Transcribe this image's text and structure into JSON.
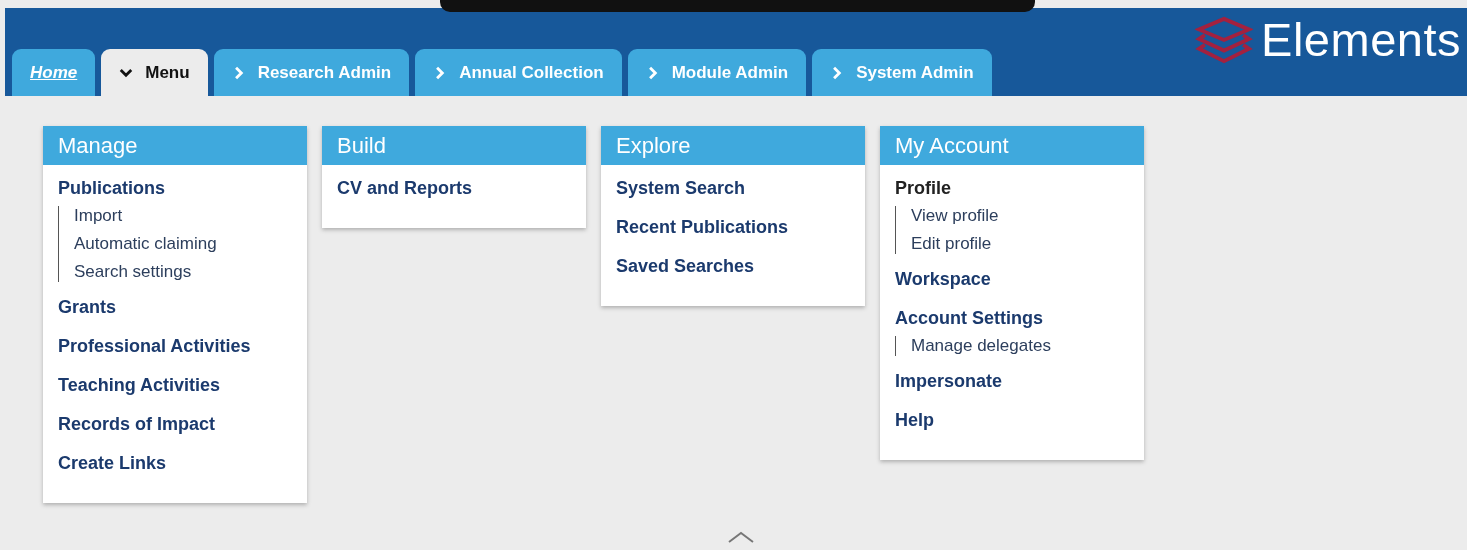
{
  "logo": {
    "text": "Elements"
  },
  "tabs": [
    {
      "label": "Home",
      "kind": "link",
      "selected": false
    },
    {
      "label": "Menu",
      "kind": "menu",
      "selected": true
    },
    {
      "label": "Research Admin",
      "kind": "menu",
      "selected": false
    },
    {
      "label": "Annual Collection",
      "kind": "menu",
      "selected": false
    },
    {
      "label": "Module Admin",
      "kind": "menu",
      "selected": false
    },
    {
      "label": "System Admin",
      "kind": "menu",
      "selected": false
    }
  ],
  "panels": [
    {
      "title": "Manage",
      "items": [
        {
          "label": "Publications",
          "selected": false,
          "children": [
            {
              "label": "Import"
            },
            {
              "label": "Automatic claiming"
            },
            {
              "label": "Search settings"
            }
          ]
        },
        {
          "label": "Grants",
          "selected": false
        },
        {
          "label": "Professional Activities",
          "selected": false
        },
        {
          "label": "Teaching Activities",
          "selected": false
        },
        {
          "label": "Records of Impact",
          "selected": false
        },
        {
          "label": "Create Links",
          "selected": false
        }
      ]
    },
    {
      "title": "Build",
      "items": [
        {
          "label": "CV and Reports",
          "selected": false
        }
      ]
    },
    {
      "title": "Explore",
      "items": [
        {
          "label": "System Search",
          "selected": false
        },
        {
          "label": "Recent Publications",
          "selected": false
        },
        {
          "label": "Saved Searches",
          "selected": false
        }
      ]
    },
    {
      "title": "My Account",
      "items": [
        {
          "label": "Profile",
          "selected": true,
          "children": [
            {
              "label": "View profile"
            },
            {
              "label": "Edit profile"
            }
          ]
        },
        {
          "label": "Workspace",
          "selected": false
        },
        {
          "label": "Account Settings",
          "selected": false,
          "children": [
            {
              "label": "Manage delegates"
            }
          ]
        },
        {
          "label": "Impersonate",
          "selected": false
        },
        {
          "label": "Help",
          "selected": false
        }
      ]
    }
  ]
}
